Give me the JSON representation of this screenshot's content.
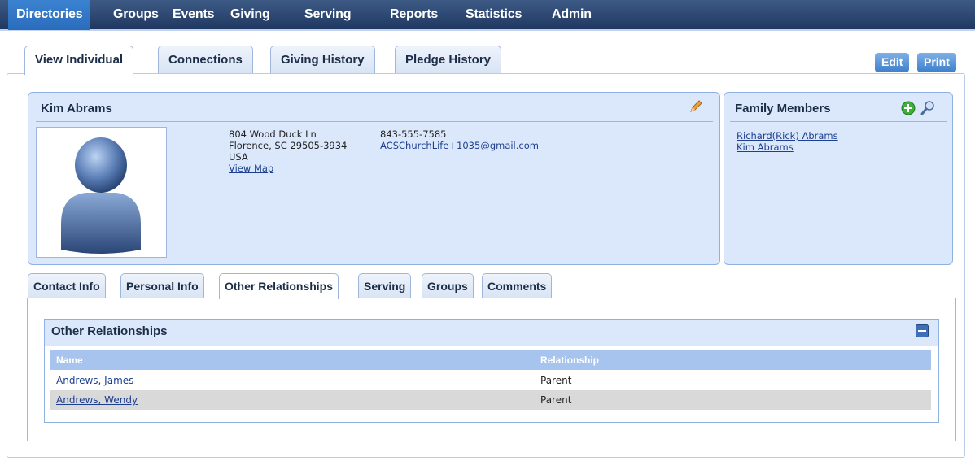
{
  "nav": {
    "items": [
      "Directories",
      "Groups",
      "Events",
      "Giving",
      "Serving",
      "Reports",
      "Statistics",
      "Admin"
    ]
  },
  "main_tabs": [
    "View Individual",
    "Connections",
    "Giving History",
    "Pledge History"
  ],
  "actions": {
    "edit": "Edit",
    "print": "Print"
  },
  "person": {
    "name": "Kim Abrams",
    "address": {
      "street": "804 Wood Duck Ln",
      "city_line": "Florence, SC 29505-3934",
      "country": "USA",
      "map_link": "View Map"
    },
    "phone": "843-555-7585",
    "email": "ACSChurchLife+1035@gmail.com"
  },
  "family": {
    "title": "Family Members",
    "members": [
      "Richard(Rick) Abrams",
      "Kim Abrams"
    ]
  },
  "sub_tabs": [
    "Contact Info",
    "Personal Info",
    "Other Relationships",
    "Serving",
    "Groups",
    "Comments"
  ],
  "relationships": {
    "title": "Other Relationships",
    "columns": [
      "Name",
      "Relationship"
    ],
    "rows": [
      {
        "name": "Andrews, James",
        "relationship": "Parent"
      },
      {
        "name": "Andrews, Wendy",
        "relationship": "Parent"
      }
    ]
  },
  "colors": {
    "nav_bg": "#1f3860",
    "active_nav": "#2a6cbc",
    "panel_bg": "#dbe8fb",
    "header_row": "#a7c4ef"
  },
  "icons": [
    "pencil-edit-icon",
    "add-green-icon",
    "search-magnifier-icon",
    "collapse-minus-icon",
    "user-avatar-icon"
  ]
}
